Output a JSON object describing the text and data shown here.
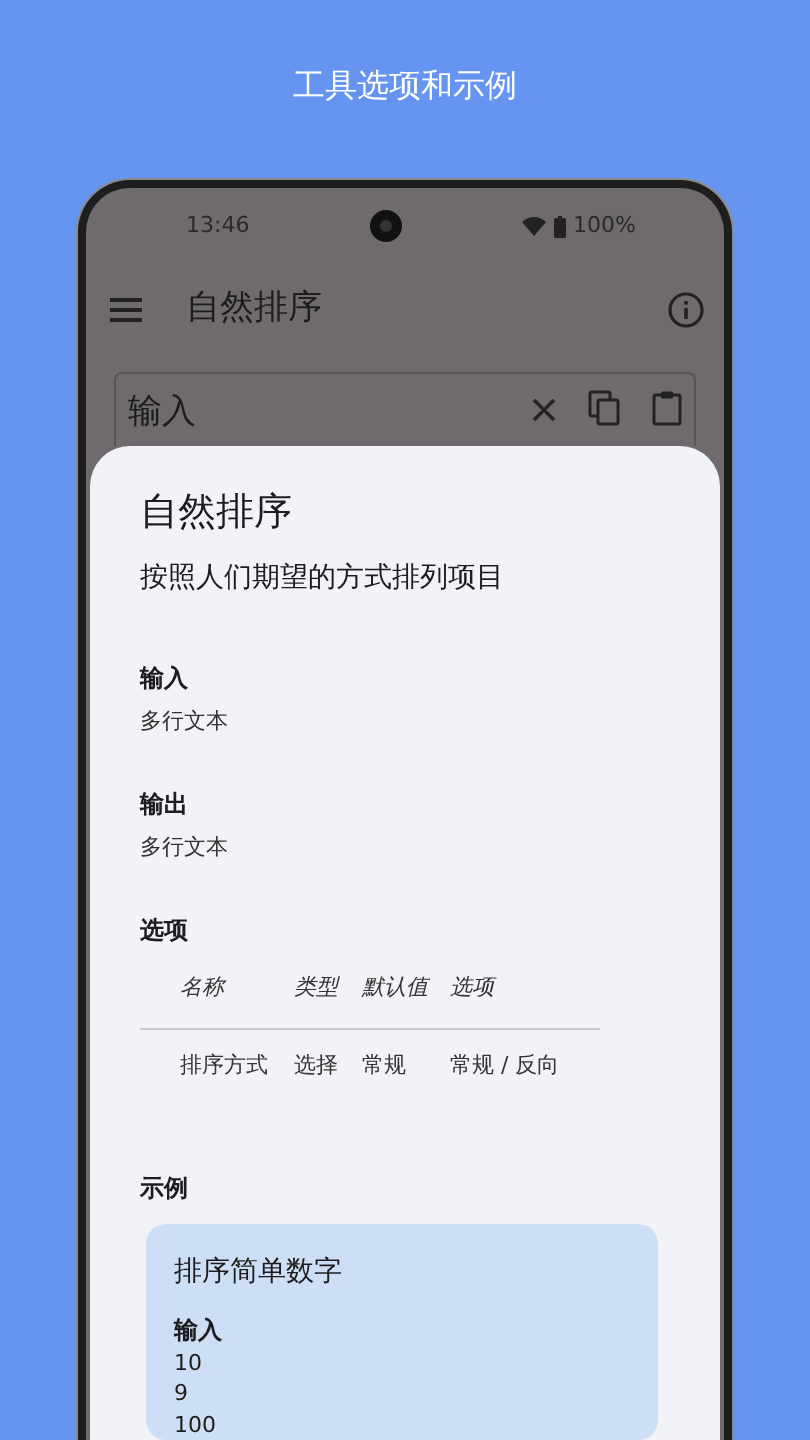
{
  "headline": "工具选项和示例",
  "status_bar": {
    "time": "13:46",
    "battery": "100%"
  },
  "app_bar": {
    "title": "自然排序"
  },
  "input_field": {
    "label": "输入"
  },
  "sheet": {
    "title": "自然排序",
    "description": "按照人们期望的方式排列项目",
    "sections": [
      {
        "heading": "输入",
        "text": "多行文本"
      },
      {
        "heading": "输出",
        "text": "多行文本"
      }
    ],
    "options": {
      "heading": "选项",
      "columns": [
        "名称",
        "类型",
        "默认值",
        "选项"
      ],
      "rows": [
        [
          "排序方式",
          "选择",
          "常规",
          "常规 / 反向"
        ]
      ]
    },
    "examples": {
      "heading": "示例",
      "items": [
        {
          "title": "排序简单数字",
          "input_label": "输入",
          "input_lines": [
            "10",
            "9",
            "100"
          ]
        }
      ]
    }
  }
}
